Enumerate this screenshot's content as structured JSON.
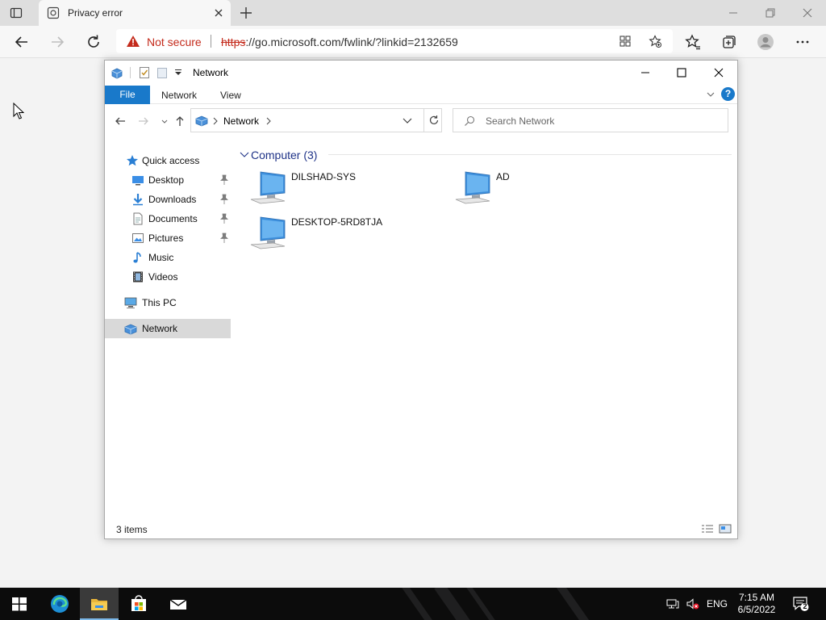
{
  "browser": {
    "tab": {
      "title": "Privacy error"
    },
    "address": {
      "security_label": "Not secure",
      "url_scheme": "https",
      "url_rest": "://go.microsoft.com/fwlink/?linkid=2132659"
    }
  },
  "explorer": {
    "title": "Network",
    "ribbon": {
      "tabs": [
        "File",
        "Network",
        "View"
      ],
      "help": "?"
    },
    "path": {
      "location": "Network"
    },
    "search": {
      "placeholder": "Search Network"
    },
    "nav": {
      "quick_access": "Quick access",
      "quick_items": [
        {
          "label": "Desktop",
          "icon": "desktop-folder-icon",
          "pinned": true
        },
        {
          "label": "Downloads",
          "icon": "downloads-folder-icon",
          "pinned": true
        },
        {
          "label": "Documents",
          "icon": "documents-folder-icon",
          "pinned": true
        },
        {
          "label": "Pictures",
          "icon": "pictures-folder-icon",
          "pinned": true
        },
        {
          "label": "Music",
          "icon": "music-folder-icon",
          "pinned": false
        },
        {
          "label": "Videos",
          "icon": "videos-folder-icon",
          "pinned": false
        }
      ],
      "this_pc": "This PC",
      "network": "Network",
      "selected": "Network"
    },
    "content": {
      "group_title": "Computer (3)",
      "computers": [
        "DILSHAD-SYS",
        "AD",
        "DESKTOP-5RD8TJA"
      ]
    },
    "status": {
      "items_count": "3 items"
    }
  },
  "taskbar": {
    "pinned": [
      "start-button",
      "edge-icon",
      "file-explorer-icon",
      "store-icon",
      "mail-icon"
    ],
    "active": "file-explorer-icon",
    "language": "ENG",
    "time": "7:15 AM",
    "date": "6/5/2022",
    "notification_count": "2"
  },
  "colors": {
    "accent": "#1979ca",
    "warning": "#c42b1c",
    "group_title": "#1e3287",
    "taskbar": "#0c0c0c"
  }
}
